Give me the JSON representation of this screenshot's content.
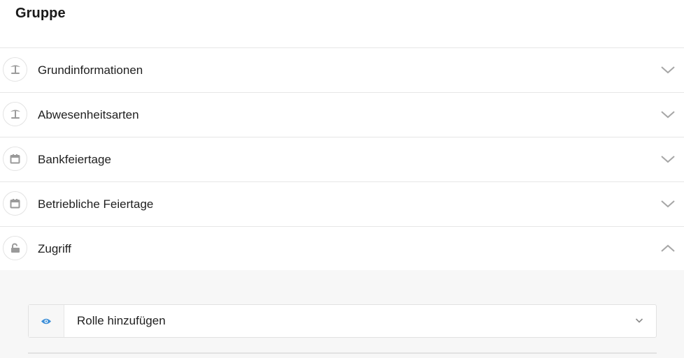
{
  "page": {
    "title": "Gruppe"
  },
  "accordion": {
    "items": [
      {
        "label": "Grundinformationen",
        "icon": "palm-tree-icon",
        "expanded": false
      },
      {
        "label": "Abwesenheitsarten",
        "icon": "palm-tree-icon",
        "expanded": false
      },
      {
        "label": "Bankfeiertage",
        "icon": "calendar-icon",
        "expanded": false
      },
      {
        "label": "Betriebliche Feiertage",
        "icon": "calendar-icon",
        "expanded": false
      },
      {
        "label": "Zugriff",
        "icon": "unlock-icon",
        "expanded": true
      }
    ]
  },
  "access": {
    "role_select": {
      "label": "Rolle hinzufügen",
      "icon": "eye-icon"
    }
  },
  "colors": {
    "accent": "#3d8fd8",
    "icon_gray": "#9a9a9a",
    "chevron_gray": "#a6a6a6",
    "panel_bg": "#f7f7f7",
    "divider": "#e6e6e6"
  }
}
